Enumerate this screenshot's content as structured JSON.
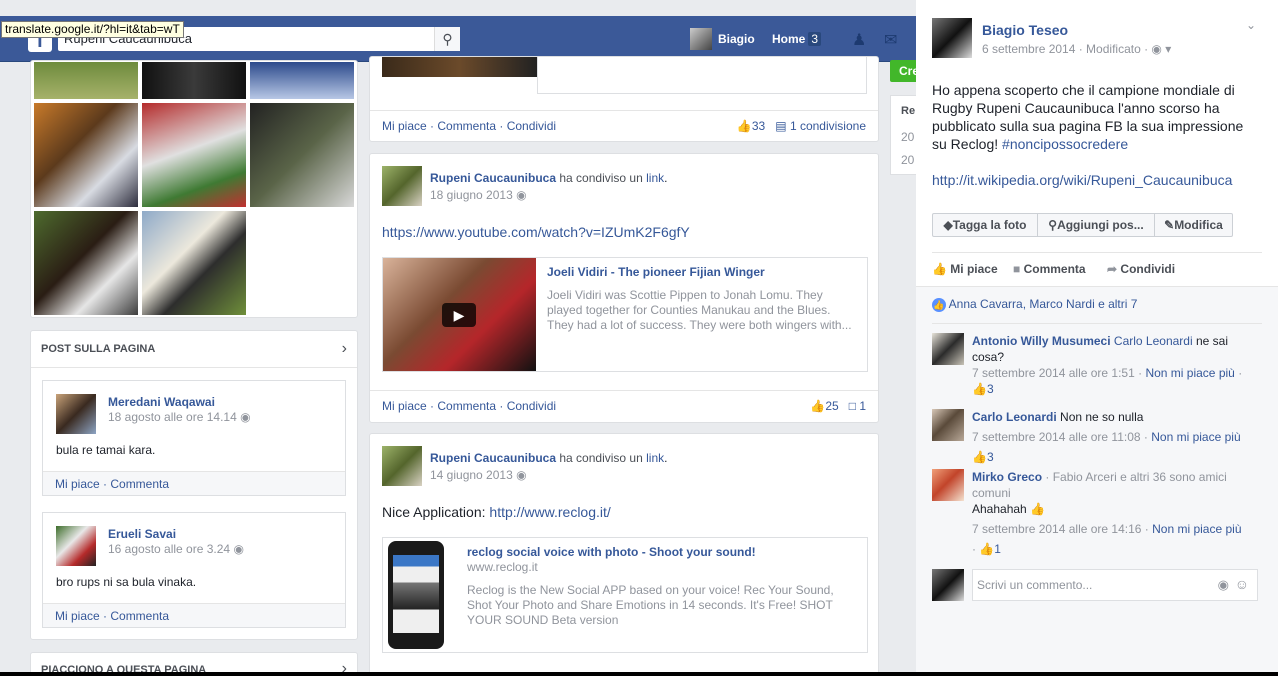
{
  "tooltip": "translate.google.it/?hl=it&tab=wT",
  "topbar": {
    "logo": "f",
    "search_value": "Rupeni Caucaunibuca",
    "user_name": "Biagio",
    "home_label": "Home",
    "home_count": "3"
  },
  "left_column": {
    "posts_header": "POST SULLA PAGINA",
    "likes_header": "PIACCIONO A QUESTA PAGINA",
    "posts": [
      {
        "author": "Meredani Waqawai",
        "date": "18 agosto alle ore 14.14",
        "text": "bula re tamai kara.",
        "actions": "Mi piace · Commenta"
      },
      {
        "author": "Erueli Savai",
        "date": "16 agosto alle ore 3.24",
        "text": "bro rups ni sa bula vinaka.",
        "actions": "Mi piace · Commenta"
      }
    ]
  },
  "feed": {
    "post0": {
      "actions": "Mi piace · Commenta · Condividi",
      "likes": "33",
      "shares": "1 condivisione"
    },
    "post1": {
      "author": "Rupeni Caucaunibuca",
      "shared": "ha condiviso un",
      "link_word": "link",
      "date": "18 giugno 2013",
      "url": "https://www.youtube.com/watch?v=IZUmK2F6gfY",
      "link_title": "Joeli Vidiri - The pioneer Fijian Winger",
      "link_desc": "Joeli Vidiri was Scottie Pippen to Jonah Lomu. They played together for Counties Manukau and the Blues. They had a lot of success. They were both wingers with...",
      "actions": "Mi piace · Commenta · Condividi",
      "likes": "25",
      "comments": "1"
    },
    "post2": {
      "author": "Rupeni Caucaunibuca",
      "shared": "ha condiviso un",
      "link_word": "link",
      "date": "14 giugno 2013",
      "text_prefix": "Nice Application:",
      "text_link": "http://www.reclog.it/",
      "link_title": "reclog social voice with photo - Shoot your sound!",
      "link_domain": "www.reclog.it",
      "link_desc": "Reclog is the New Social APP based on your voice! Rec Your Sound, Shot Your Photo and Share Emotions in 14 seconds. It's Free! SHOT YOUR SOUND Beta version"
    }
  },
  "side_column": {
    "create_btn": "Cre",
    "recent_label": "Re",
    "years": [
      "20",
      "20"
    ]
  },
  "photo_viewer": {
    "author": "Biagio Teseo",
    "date": "6 settembre 2014 · Modificato ·",
    "caption": "Ho appena scoperto che il campione mondiale di Rugby Rupeni Caucaunibuca l'anno scorso ha pubblicato sulla sua pagina FB la sua impressione su Reclog!",
    "hashtag": "#noncipossocredere",
    "wiki_link": "http://it.wikipedia.org/wiki/Rupeni_Caucaunibuca",
    "tag_btn": "Tagga la foto",
    "place_btn": "Aggiungi pos...",
    "edit_btn": "Modifica",
    "like": "Mi piace",
    "comment": "Commenta",
    "share": "Condividi",
    "likers": "Anna Cavarra, Marco Nardi e altri 7",
    "comments": [
      {
        "author": "Antonio Willy Musumeci",
        "mention": "Carlo Leonardi",
        "text": "ne sai cosa?",
        "meta": "7 settembre 2014 alle ore 1:51 ·",
        "unlike": "Non mi piace più",
        "likes": "3"
      },
      {
        "author": "Carlo Leonardi",
        "text": "Non ne so nulla",
        "meta": "7 settembre 2014 alle ore 11:08 ·",
        "unlike": "Non mi piace più",
        "likes": "3"
      },
      {
        "author": "Mirko Greco",
        "friends": "· Fabio Arceri e altri 36 sono amici comuni",
        "text": "Ahahahah",
        "meta": "7 settembre 2014 alle ore 14:16 ·",
        "unlike": "Non mi piace più",
        "likes": "1"
      }
    ],
    "comment_placeholder": "Scrivi un commento..."
  }
}
